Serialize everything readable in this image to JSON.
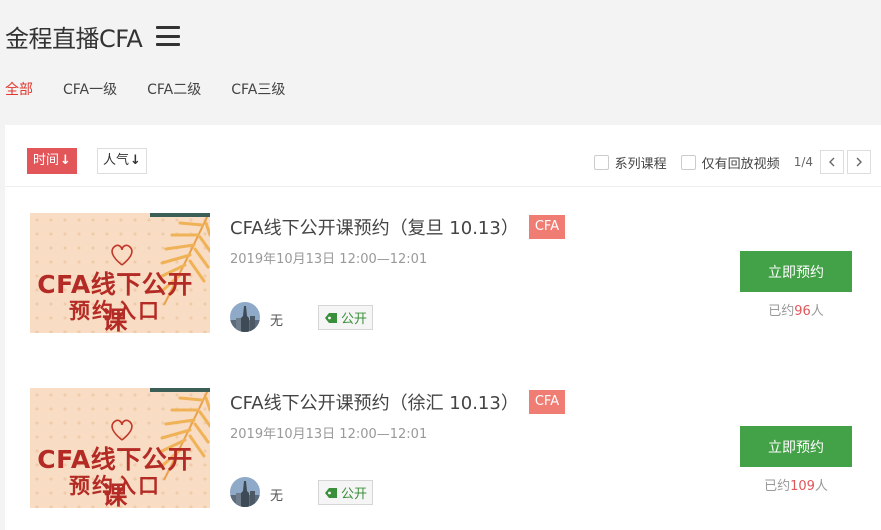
{
  "header": {
    "title": "金程直播CFA",
    "menu_icon": "hamburger-menu-icon"
  },
  "categories": [
    {
      "label": "全部",
      "active": true
    },
    {
      "label": "CFA一级",
      "active": false
    },
    {
      "label": "CFA二级",
      "active": false
    },
    {
      "label": "CFA三级",
      "active": false
    }
  ],
  "toolbar": {
    "sort_time": "时间",
    "sort_hot": "人气",
    "sort_arrow": "↓",
    "filter_series": "系列课程",
    "filter_replay": "仅有回放视频",
    "pager": "1/4",
    "prev_icon": "chevron-left-icon",
    "next_icon": "chevron-right-icon"
  },
  "courses": [
    {
      "title": "CFA线下公开课预约（复旦 10.13）",
      "tag": "CFA",
      "time": "2019年10月13日 12:00—12:01",
      "teacher": "无",
      "public_label": "公开",
      "button": "立即预约",
      "count_prefix": "已约",
      "count": "96",
      "count_suffix": "人",
      "thumb_line1": "CFA线下公开课",
      "thumb_line2": "预约入口"
    },
    {
      "title": "CFA线下公开课预约（徐汇 10.13）",
      "tag": "CFA",
      "time": "2019年10月13日 12:00—12:01",
      "teacher": "无",
      "public_label": "公开",
      "button": "立即预约",
      "count_prefix": "已约",
      "count": "109",
      "count_suffix": "人",
      "thumb_line1": "CFA线下公开课",
      "thumb_line2": "预约入口"
    }
  ],
  "colors": {
    "accent_red": "#e2565a",
    "button_green": "#43a147",
    "tag_red": "#ef7d73",
    "public_green": "#3a8f3a"
  }
}
